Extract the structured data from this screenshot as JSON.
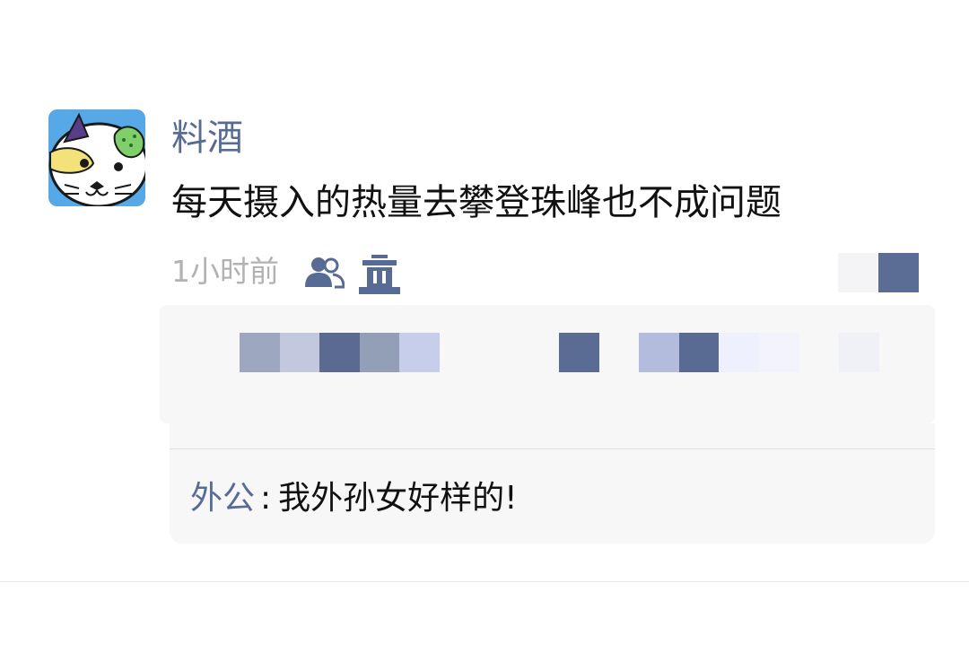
{
  "post": {
    "username": "料酒",
    "text": "每天摄入的热量去攀登珠峰也不成问题",
    "timestamp": "1小时前"
  },
  "icons": {
    "avatar": "cat-avatar-icon",
    "visibility": "contacts-visibility-icon",
    "delete": "trash-icon",
    "more": "more-actions-icon"
  },
  "comment": {
    "author": "外公",
    "separator": ":",
    "text": "我外孙女好样的!"
  },
  "colors": {
    "link_blue": "#576b95",
    "text": "#111111",
    "meta_gray": "#b2b2b2",
    "panel_bg": "#f7f7f7",
    "avatar_bg": "#56a8e6"
  }
}
